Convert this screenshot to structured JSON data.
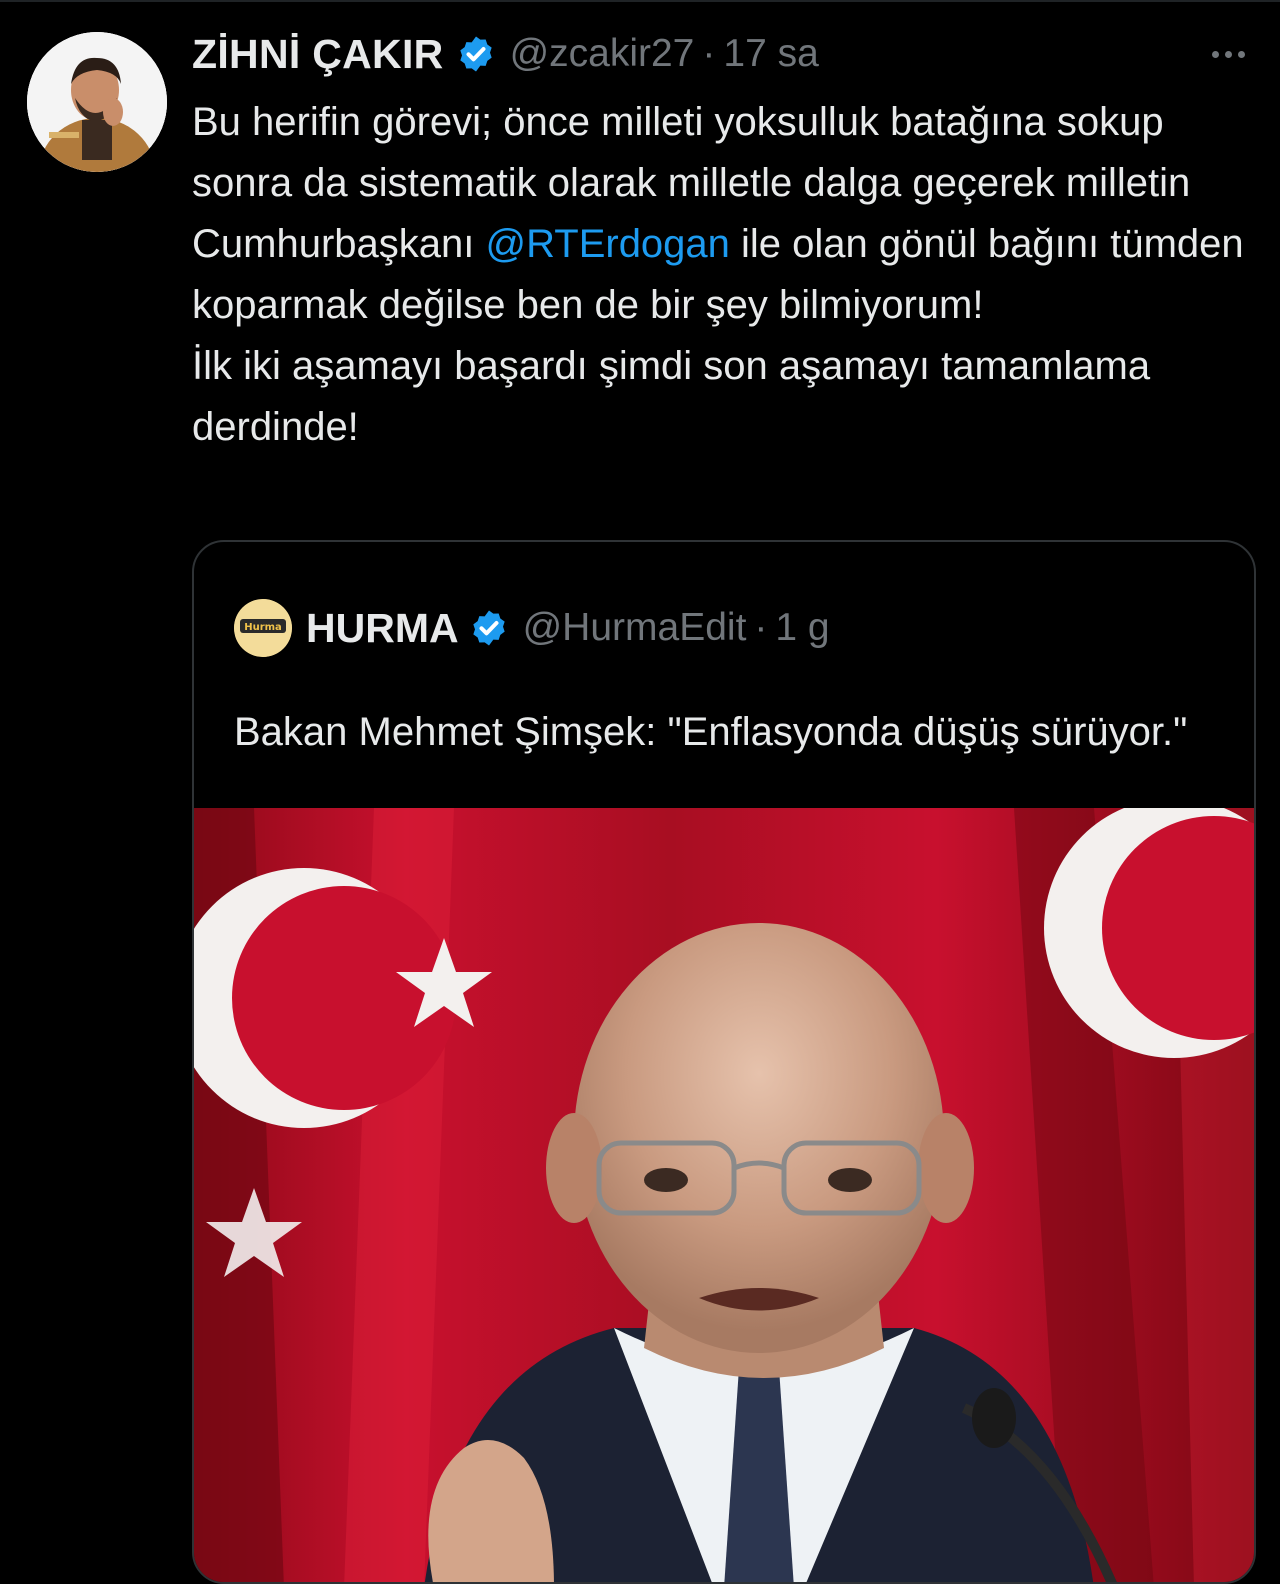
{
  "tweet": {
    "display_name": "ZİHNİ ÇAKIR",
    "handle": "@zcakir27",
    "separator": "·",
    "time": "17 sa",
    "text_part1": "Bu herifin görevi; önce milleti yoksulluk batağına sokup sonra da sistematik olarak milletle dalga geçerek milletin Cumhurbaşkanı ",
    "mention": "@RTErdogan",
    "text_part2": " ile olan gönül bağını tümden koparmak değilse ben de bir şey bilmiyorum!",
    "text_line2": "İlk iki aşamayı başardı şimdi son aşamayı tamamlama derdinde!"
  },
  "quote": {
    "display_name": "HURMA",
    "handle": "@HurmaEdit",
    "separator": "·",
    "time": "1 g",
    "text": "Bakan Mehmet Şimşek: \"Enflasyonda düşüş sürüyor.\"",
    "avatar_logo_text": "Hurma"
  },
  "icons": {
    "verified": "verified-badge-icon",
    "more": "more-options-icon"
  },
  "colors": {
    "background": "#000000",
    "text": "#e7e9ea",
    "muted": "#71767b",
    "accent": "#1d9bf0",
    "border": "#2f3336",
    "flag_red": "#c8102e"
  }
}
